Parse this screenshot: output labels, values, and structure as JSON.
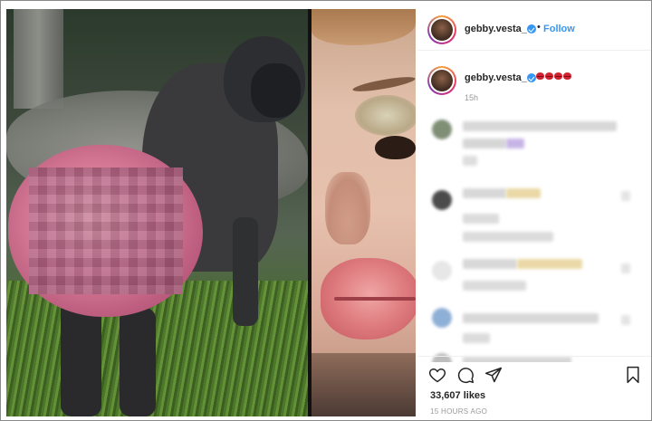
{
  "post": {
    "username": "gebby.vesta_",
    "follow_label": "Follow",
    "separator": "•",
    "caption_time": "15h",
    "likes": "33,607 likes",
    "timestamp": "15 HOURS AGO",
    "caption_emoji": [
      "lips-icon",
      "lips-icon",
      "lips-icon",
      "lips-icon"
    ]
  },
  "colors": {
    "link_blue": "#3897f0",
    "verified_blue": "#3897f0",
    "secondary_text": "#999999",
    "lip_red": "#d0232f"
  },
  "actions": [
    "heart-icon",
    "comment-icon",
    "share-icon",
    "bookmark-icon"
  ]
}
